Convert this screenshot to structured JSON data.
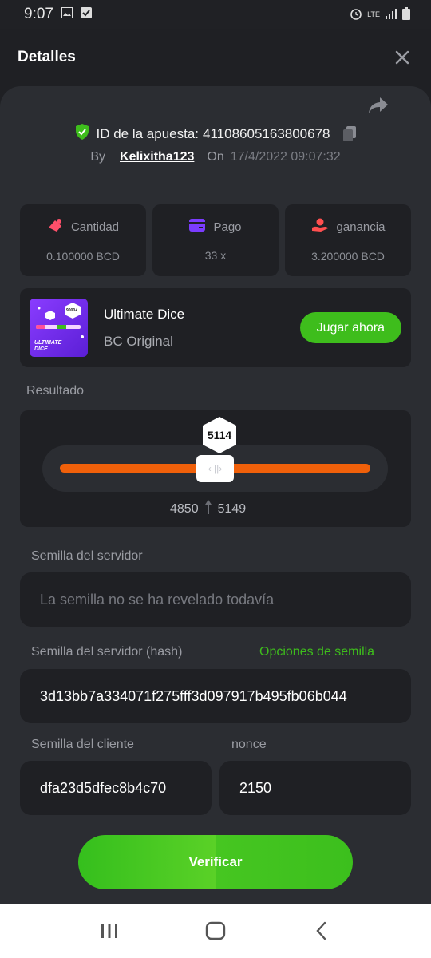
{
  "status_bar": {
    "time": "9:07",
    "network": "LTE"
  },
  "header": {
    "title": "Detalles"
  },
  "bet": {
    "id_label": "ID de la apuesta:",
    "id_value": "41108605163800678",
    "by_label": "By",
    "user": "Kelixitha123",
    "on_label": "On",
    "date": "17/4/2022 09:07:32"
  },
  "stats": [
    {
      "label": "Cantidad",
      "value": "0.100000 BCD",
      "icon": "coins-icon",
      "color": "#ff4f6a"
    },
    {
      "label": "Pago",
      "value": "33 x",
      "icon": "card-icon",
      "color": "#7b3cff"
    },
    {
      "label": "ganancia",
      "value": "3.200000 BCD",
      "icon": "hand-coin-icon",
      "color": "#ff4f4f"
    }
  ],
  "game": {
    "name": "Ultimate Dice",
    "provider": "BC Original",
    "play_label": "Jugar ahora",
    "thumb_badge": "9000+",
    "thumb_title": "ULTIMATE DICE"
  },
  "result": {
    "label": "Resultado",
    "value": "5114",
    "range_low": "4850",
    "range_high": "5149"
  },
  "seeds": {
    "server_label": "Semilla del servidor",
    "server_placeholder": "La semilla no se ha revelado todavía",
    "server_hash_label": "Semilla del servidor (hash)",
    "seed_options_label": "Opciones de semilla",
    "server_hash": "3d13bb7a334071f275fff3d097917b495fb06b044",
    "client_label": "Semilla del cliente",
    "client_seed": "dfa23d5dfec8b4c70",
    "nonce_label": "nonce",
    "nonce": "2150"
  },
  "verify_label": "Verificar",
  "colors": {
    "accent_green": "#3ebd1c",
    "orange_bar": "#f0600a",
    "panel": "#2b2d32",
    "background": "#1f2024"
  }
}
